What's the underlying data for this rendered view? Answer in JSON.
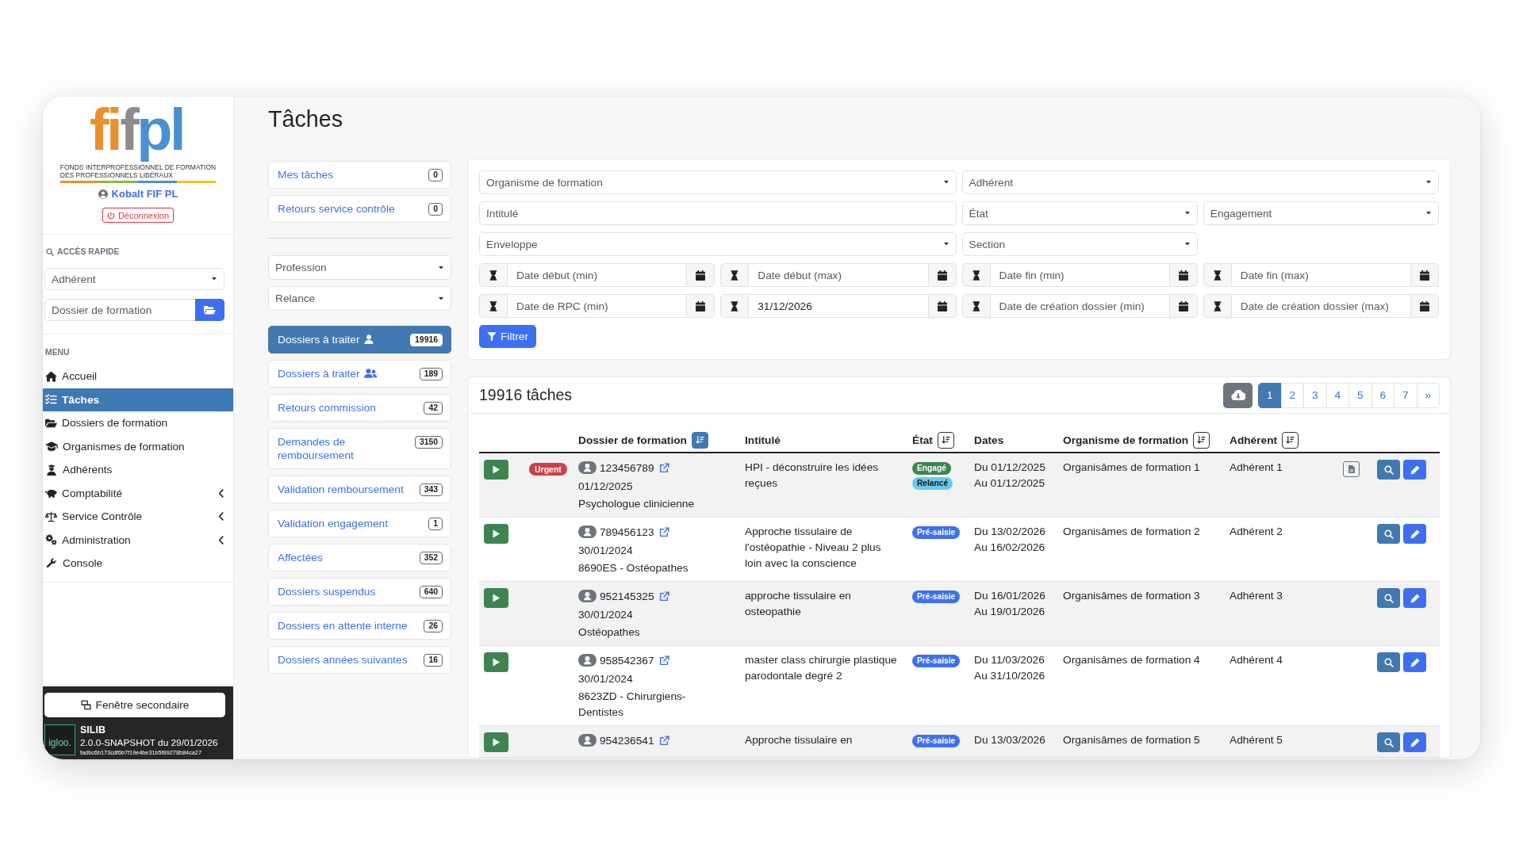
{
  "sidebar": {
    "logo": {
      "parts": [
        {
          "text": "fi",
          "color": "#e8912d"
        },
        {
          "text": "f",
          "color": "#8c8c8c"
        },
        {
          "text": "pl",
          "color": "#4a90d2"
        }
      ],
      "tagline": [
        "FONDS INTERPROFESSIONNEL DE FORMATION",
        "DES PROFESSIONNELS LIBÉRAUX"
      ]
    },
    "user": "Kobalt FIF PL",
    "logout": "Déconnexion",
    "quick_access": {
      "title": "ACCÈS RAPIDE",
      "member_select": {
        "placeholder": "Adhérent"
      },
      "dossier_search": {
        "placeholder": "Dossier de formation"
      }
    },
    "menu": {
      "title": "MENU",
      "items": [
        {
          "label": "Accueil",
          "selected": false,
          "expandable": false
        },
        {
          "label": "Tâches",
          "selected": true,
          "expandable": false
        },
        {
          "label": "Dossiers de formation",
          "selected": false,
          "expandable": false
        },
        {
          "label": "Organismes de formation",
          "selected": false,
          "expandable": false
        },
        {
          "label": "Adhérents",
          "selected": false,
          "expandable": false
        },
        {
          "label": "Comptabilité",
          "selected": false,
          "expandable": true
        },
        {
          "label": "Service Contrôle",
          "selected": false,
          "expandable": true
        },
        {
          "label": "Administration",
          "selected": false,
          "expandable": true
        },
        {
          "label": "Console",
          "selected": false,
          "expandable": false
        }
      ]
    },
    "secondary_window_button": "Fenêtre secondaire",
    "footer": {
      "logo": "igloo.",
      "app": "SILIB",
      "version": "2.0.0-SNAPSHOT du 29/01/2026",
      "build": "fadbc6b173cdf6b7f19e4be31b5f89278b84ca27"
    }
  },
  "page_title": "Tâches",
  "task_lists": {
    "mine": [
      {
        "label": "Mes tâches",
        "count": "0",
        "selected": false
      },
      {
        "label": "Retours service contrôle",
        "count": "0",
        "selected": false
      }
    ],
    "selects": [
      {
        "placeholder": "Profession"
      },
      {
        "placeholder": "Relance"
      }
    ],
    "queues": [
      {
        "label": "Dossiers à traiter",
        "kind": "personal",
        "count": "19916",
        "selected": true
      },
      {
        "label": "Dossiers à traiter",
        "kind": "team",
        "count": "189",
        "selected": false
      },
      {
        "label": "Retours commission",
        "kind": "plain",
        "count": "42",
        "selected": false
      },
      {
        "label": "Demandes de remboursement",
        "kind": "plain",
        "count": "3150",
        "selected": false
      },
      {
        "label": "Validation remboursement",
        "kind": "plain",
        "count": "343",
        "selected": false
      },
      {
        "label": "Validation engagement",
        "kind": "plain",
        "count": "1",
        "selected": false
      },
      {
        "label": "Affectées",
        "kind": "plain",
        "count": "352",
        "selected": false
      },
      {
        "label": "Dossiers suspendus",
        "kind": "plain",
        "count": "640",
        "selected": false
      },
      {
        "label": "Dossiers en attente interne",
        "kind": "plain",
        "count": "26",
        "selected": false
      },
      {
        "label": "Dossiers années suivantes",
        "kind": "plain",
        "count": "16",
        "selected": false
      }
    ]
  },
  "filters": {
    "fields": [
      {
        "kind": "select",
        "placeholder": "Organisme de formation"
      },
      {
        "kind": "select",
        "placeholder": "Adhérent"
      },
      {
        "kind": "text",
        "placeholder": "Intitulé"
      },
      {
        "kind": "select",
        "placeholder": "État"
      },
      {
        "kind": "select",
        "placeholder": "Engagement"
      },
      {
        "kind": "select",
        "placeholder": "Enveloppe"
      },
      {
        "kind": "select",
        "placeholder": "Section"
      },
      {
        "kind": "date",
        "placeholder": "Date début (min)"
      },
      {
        "kind": "date",
        "placeholder": "Date début (max)"
      },
      {
        "kind": "date",
        "placeholder": "Date fin (min)"
      },
      {
        "kind": "date",
        "placeholder": "Date fin (max)"
      },
      {
        "kind": "date",
        "placeholder": "Date de RPC (min)"
      },
      {
        "kind": "date",
        "value": "31/12/2026"
      },
      {
        "kind": "date",
        "placeholder": "Date de création dossier (min)"
      },
      {
        "kind": "date",
        "placeholder": "Date de création dossier (max)"
      }
    ],
    "submit": "Filtrer"
  },
  "results": {
    "title": "19916 tâches",
    "pages": [
      {
        "label": "1",
        "selected": true
      },
      {
        "label": "2",
        "selected": false
      },
      {
        "label": "3",
        "selected": false
      },
      {
        "label": "4",
        "selected": false
      },
      {
        "label": "5",
        "selected": false
      },
      {
        "label": "6",
        "selected": false
      },
      {
        "label": "7",
        "selected": false
      }
    ],
    "next": "»",
    "columns": [
      {
        "label": "Dossier de formation",
        "sorted": true
      },
      {
        "label": "Intitulé"
      },
      {
        "label": "État",
        "sorted": false
      },
      {
        "label": "Dates"
      },
      {
        "label": "Organisme de formation",
        "sorted": false
      },
      {
        "label": "Adhérent",
        "sorted": false
      }
    ],
    "rows": [
      {
        "flag": "Urgent",
        "dossier": "123456789",
        "date": "01/12/2025",
        "profession": "Psychologue clinicienne",
        "title": "HPI - déconstruire les idées reçues",
        "states": [
          {
            "label": "Engagé",
            "color": "#3f8450"
          },
          {
            "label": "Relancé",
            "color": "#6cc9ec"
          }
        ],
        "dates": [
          "Du 01/12/2025",
          "Au 01/12/2025"
        ],
        "organisme": "Organisâmes de formation 1",
        "adherent": "Adhérent 1",
        "document": true
      },
      {
        "dossier": "789456123",
        "date": "30/01/2024",
        "profession": "8690ES - Ostéopathes",
        "title": "Approche tissulaire de l'ostéopathie - Niveau 2 plus loin avec la conscience",
        "states": [
          {
            "label": "Pré-saisie",
            "color": "#3e6ff0"
          }
        ],
        "dates": [
          "Du 13/02/2026",
          "Au 16/02/2026"
        ],
        "organisme": "Organisâmes de formation 2",
        "adherent": "Adhérent 2",
        "document": false
      },
      {
        "dossier": "952145325",
        "date": "30/01/2024",
        "profession": "Ostéopathes",
        "title": "approche tissulaire en osteopathie",
        "states": [
          {
            "label": "Pré-saisie",
            "color": "#3e6ff0"
          }
        ],
        "dates": [
          "Du 16/01/2026",
          "Au 19/01/2026"
        ],
        "organisme": "Organisâmes de formation 3",
        "adherent": "Adhérent 3",
        "document": false
      },
      {
        "dossier": "958542367",
        "date": "30/01/2024",
        "profession": "8623ZD - Chirurgiens-Dentistes",
        "title": "master class chirurgie plastique parodontale degré 2",
        "states": [
          {
            "label": "Pré-saisie",
            "color": "#3e6ff0"
          }
        ],
        "dates": [
          "Du 11/03/2026",
          "Au 31/10/2026"
        ],
        "organisme": "Organisâmes de formation 4",
        "adherent": "Adhérent 4",
        "document": false
      },
      {
        "dossier": "954236541",
        "title": "Approche tissulaire en",
        "states": [
          {
            "label": "Pré-saisie",
            "color": "#3e6ff0"
          }
        ],
        "dates": [
          "Du 13/03/2026"
        ],
        "organisme": "Organisâmes de formation 5",
        "adherent": "Adhérent 5",
        "document": false
      }
    ]
  }
}
